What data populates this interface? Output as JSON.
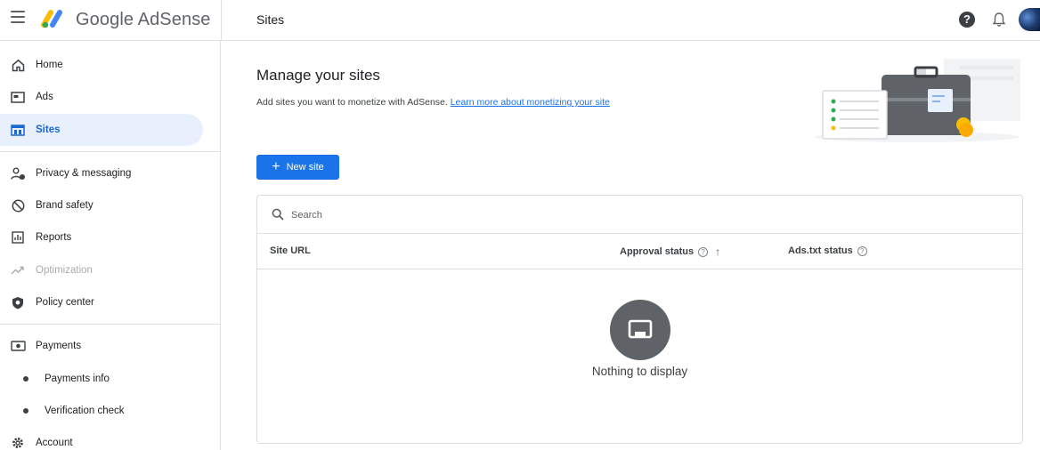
{
  "app": {
    "brand": "Google AdSense",
    "page_title": "Sites"
  },
  "colors": {
    "accent": "#1a73e8",
    "active_bg": "#e8f0fe",
    "active_text": "#1967d2"
  },
  "sidebar": {
    "items": [
      {
        "label": "Home",
        "icon": "home-icon"
      },
      {
        "label": "Ads",
        "icon": "ads-icon"
      },
      {
        "label": "Sites",
        "icon": "sites-icon",
        "active": true
      },
      {
        "label": "Privacy & messaging",
        "icon": "privacy-icon"
      },
      {
        "label": "Brand safety",
        "icon": "block-icon"
      },
      {
        "label": "Reports",
        "icon": "reports-icon"
      },
      {
        "label": "Optimization",
        "icon": "trending-icon",
        "disabled": true
      },
      {
        "label": "Policy center",
        "icon": "shield-icon"
      },
      {
        "label": "Payments",
        "icon": "payments-icon"
      },
      {
        "label": "Payments info",
        "icon": "dot-icon"
      },
      {
        "label": "Verification check",
        "icon": "dot-icon"
      },
      {
        "label": "Account",
        "icon": "gear-icon"
      }
    ]
  },
  "main": {
    "title": "Manage your sites",
    "description": "Add sites you want to monetize with AdSense.",
    "learn_more": "Learn more about monetizing your site",
    "new_site_label": "New site",
    "search": {
      "placeholder": "Search",
      "value": ""
    },
    "table": {
      "columns": [
        "Site URL",
        "Approval status",
        "Ads.txt status"
      ],
      "rows": [],
      "empty_text": "Nothing to display"
    }
  }
}
